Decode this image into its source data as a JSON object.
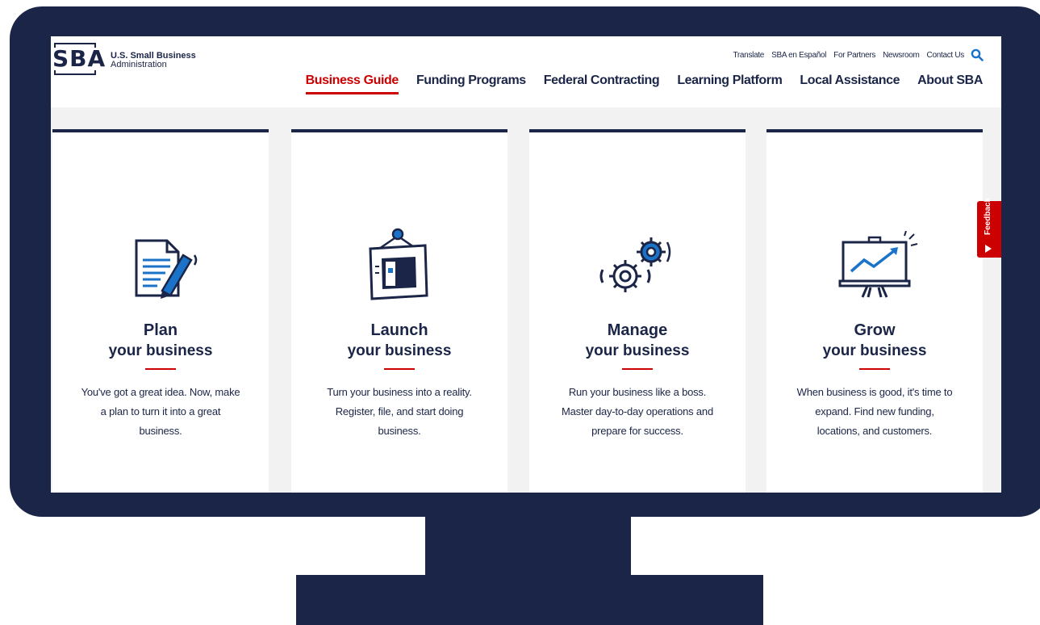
{
  "header": {
    "logo_letters": "SBA",
    "logo_line1": "U.S. Small Business",
    "logo_line2": "Administration",
    "utility_links": [
      "Translate",
      "SBA en Español",
      "For Partners",
      "Newsroom",
      "Contact Us"
    ],
    "main_nav": [
      {
        "label": "Business Guide",
        "active": true
      },
      {
        "label": "Funding Programs",
        "active": false
      },
      {
        "label": "Federal Contracting",
        "active": false
      },
      {
        "label": "Learning Platform",
        "active": false
      },
      {
        "label": "Local Assistance",
        "active": false
      },
      {
        "label": "About SBA",
        "active": false
      }
    ]
  },
  "cards": [
    {
      "title": "Plan",
      "subtitle": "your business",
      "description": "You've got a great idea. Now, make a plan to turn it into a great business.",
      "icon": "document-pencil-icon"
    },
    {
      "title": "Launch",
      "subtitle": "your business",
      "description": "Turn your business into a reality. Register, file, and start doing business.",
      "icon": "open-sign-icon"
    },
    {
      "title": "Manage",
      "subtitle": "your business",
      "description": "Run your business like a boss. Master day-to-day operations and prepare for success.",
      "icon": "gears-icon"
    },
    {
      "title": "Grow",
      "subtitle": "your business",
      "description": "When business is good, it's time to expand. Find new funding, locations, and customers.",
      "icon": "growth-chart-icon"
    }
  ],
  "feedback": {
    "label": "Feedback"
  },
  "colors": {
    "navy": "#1b2547",
    "red": "#cc0000",
    "accent_blue": "#1a73c8",
    "frame": "#1b2547"
  }
}
